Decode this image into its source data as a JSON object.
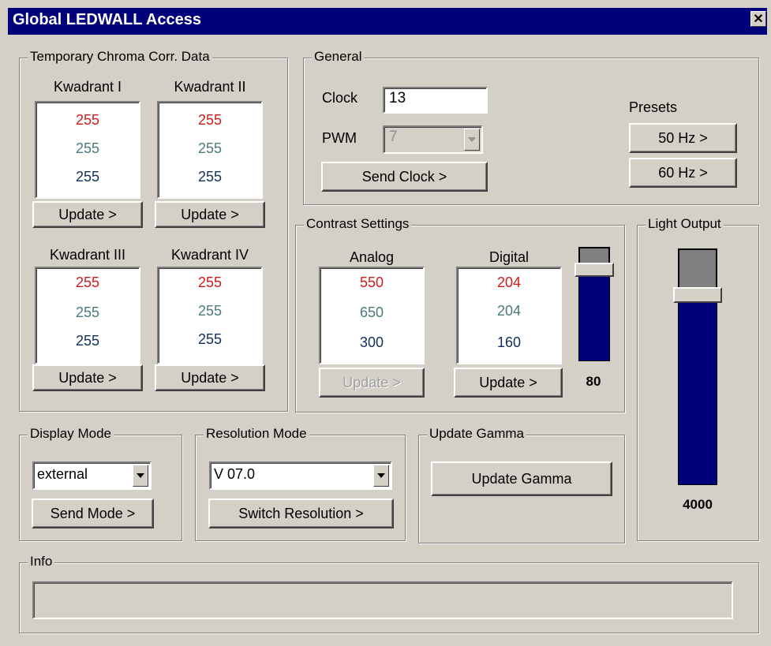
{
  "window": {
    "title": "Global LEDWALL Access",
    "close_glyph": "✕"
  },
  "chroma": {
    "legend": "Temporary Chroma Corr. Data",
    "quadrants": [
      {
        "label": "Kwadrant I",
        "values": [
          "255",
          "255",
          "255"
        ],
        "button": "Update >"
      },
      {
        "label": "Kwadrant II",
        "values": [
          "255",
          "255",
          "255"
        ],
        "button": "Update >"
      },
      {
        "label": "Kwadrant III",
        "values": [
          "255",
          "255",
          "255"
        ],
        "button": "Update >"
      },
      {
        "label": "Kwadrant IV",
        "values": [
          "255",
          "255",
          "255"
        ],
        "button": "Update >"
      }
    ]
  },
  "general": {
    "legend": "General",
    "clock_label": "Clock",
    "clock_value": "13",
    "pwm_label": "PWM",
    "pwm_value": "7",
    "send_clock": "Send Clock >",
    "presets_label": "Presets",
    "preset_50": "50 Hz >",
    "preset_60": "60 Hz >"
  },
  "contrast": {
    "legend": "Contrast Settings",
    "analog_label": "Analog",
    "analog_values": [
      "550",
      "650",
      "300"
    ],
    "analog_button": "Update >",
    "digital_label": "Digital",
    "digital_values": [
      "204",
      "204",
      "160"
    ],
    "digital_button": "Update >",
    "slider_value": "80"
  },
  "light_output": {
    "legend": "Light Output",
    "value": "4000"
  },
  "display_mode": {
    "legend": "Display Mode",
    "selected": "external",
    "button": "Send Mode >"
  },
  "resolution_mode": {
    "legend": "Resolution Mode",
    "selected": "V 07.0",
    "button": "Switch Resolution >"
  },
  "update_gamma": {
    "legend": "Update Gamma",
    "button": "Update Gamma"
  },
  "info": {
    "legend": "Info",
    "text": ""
  },
  "colors": {
    "title_bar": "#00007b",
    "value_red": "#d11a1a",
    "value_teal": "#4a7a7a",
    "value_navy": "#10305a",
    "slider_track": "#00007b"
  }
}
